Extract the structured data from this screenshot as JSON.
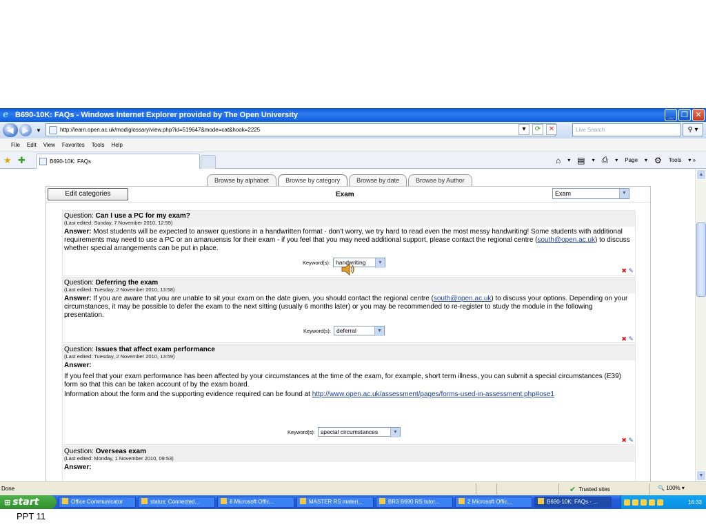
{
  "window": {
    "title": "B690-10K: FAQs - Windows Internet Explorer provided by The Open University",
    "buttons": [
      "_",
      "❐",
      "✕"
    ]
  },
  "address": {
    "url": "http://learn.open.ac.uk/mod/glossary/view.php?id=519647&mode=cat&hook=2225",
    "search_placeholder": "Live Search"
  },
  "menu": [
    "File",
    "Edit",
    "View",
    "Favorites",
    "Tools",
    "Help"
  ],
  "tab": {
    "title": "B690-10K: FAQs"
  },
  "commandbar": {
    "page": "Page",
    "tools": "Tools"
  },
  "glossary": {
    "tabs": [
      "Browse by alphabet",
      "Browse by category",
      "Browse by date",
      "Browse by Author"
    ],
    "edit_categories": "Edit categories",
    "category_title": "Exam",
    "category_select": "Exam",
    "keyword_label": "Keyword(s):",
    "entries": [
      {
        "question_label": "Question:",
        "question": "Can I use a PC for my exam?",
        "edited": "(Last edited: Sunday, 7 November 2010, 12:59)",
        "answer_label": "Answer:",
        "answer_pre": "Most students will be expected to answer questions in a handwritten format - don't worry, we try hard to read even the most messy handwriting! Some students with additional requirements may need to use a PC or an amanuensis for their exam - if you feel that you may need additional support, please contact the regional centre (",
        "link": "south@open.ac.uk",
        "answer_post": ") to discuss whether special arrangements can be put in place.",
        "keyword": "handwriting"
      },
      {
        "question_label": "Question:",
        "question": "Deferring the exam",
        "edited": "(Last edited: Tuesday, 2 November 2010, 13:58)",
        "answer_label": "Answer:",
        "answer_pre": "If you are aware that you are unable to sit your exam on the date given, you should contact the regional centre (",
        "link": "south@open.ac.uk",
        "answer_post": ") to discuss your options. Depending on your circumstances, it may be possible to defer the exam to the next sitting (usually 6 months later) or you may be recommended to re-register to study the module in the following presentation.",
        "keyword": "deferral"
      },
      {
        "question_label": "Question:",
        "question": "Issues that affect exam performance",
        "edited": "(Last edited: Tuesday, 2 November 2010, 13:59)",
        "answer_label": "Answer:",
        "para1": "If you feel that your exam performance has been affected by your circumstances at the time of the exam, for example, short term illness, you can submit a special circumstances (E39) form so that this can be taken account of by the exam board.",
        "para2_pre": "Information about the form and the supporting evidence required can be found at ",
        "link": "http://www.open.ac.uk/assessment/pages/forms-used-in-assessment.php#ose1",
        "keyword": "special circumstances"
      },
      {
        "question_label": "Question:",
        "question": "Overseas exam",
        "edited": "(Last edited: Monday, 1 November 2010, 09:53)",
        "answer_label": "Answer:"
      }
    ]
  },
  "status": {
    "done": "Done",
    "zone": "Trusted sites",
    "zoom": "100%"
  },
  "taskbar": {
    "start": "start",
    "items": [
      "Office Communicator",
      "status: Connected...",
      "8 Microsoft Offic...",
      "MASTER RS materi...",
      "BR3 B690 RS tutor...",
      "2 Microsoft Offic...",
      "B690-10K: FAQs - ..."
    ],
    "clock": "16:33"
  },
  "slide_label": "PPT 11"
}
